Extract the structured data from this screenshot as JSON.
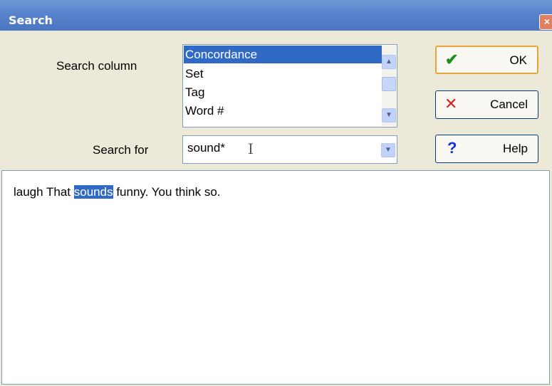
{
  "window": {
    "title": "Search",
    "close_glyph": "×"
  },
  "search_column": {
    "label": "Search column",
    "options": [
      "Concordance",
      "Set",
      "Tag",
      "Word #"
    ],
    "selected": "Concordance"
  },
  "search_for": {
    "label": "Search for",
    "value": "sound*"
  },
  "buttons": {
    "ok": "OK",
    "cancel": "Cancel",
    "help": "Help"
  },
  "icons": {
    "ok": "checkmark-icon",
    "cancel": "x-icon",
    "help": "question-icon"
  },
  "result": {
    "before": "laugh That ",
    "highlight": "sounds",
    "after": " funny. You think so."
  },
  "colors": {
    "accent": "#316ac5",
    "titlebar": "#5883cc",
    "ok_icon": "#1c8f1c",
    "cancel_icon": "#d81e1e",
    "help_icon": "#1533d0"
  }
}
